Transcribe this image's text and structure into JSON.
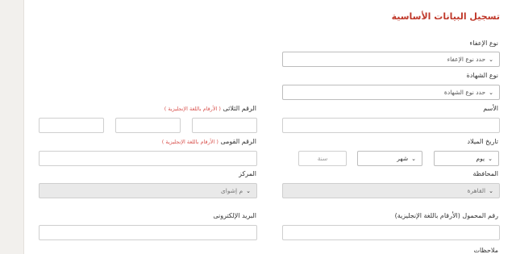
{
  "title": "تسجيل البيانات الأساسية",
  "exemption_type": {
    "label": "نوع الإعفاء",
    "value": "حدد نوع الإعفاء"
  },
  "certificate_type": {
    "label": "نوع الشهادة",
    "value": "حدد نوع الشهادة"
  },
  "name": {
    "label": "الأسم"
  },
  "triple_number": {
    "label": "الرقم الثلاثى",
    "hint": "( الأرقام باللغة الإنجليزية )"
  },
  "birth_date": {
    "label": "تاريخ الميلاد",
    "day": "يوم",
    "month": "شهر",
    "year_placeholder": "سنة"
  },
  "national_id": {
    "label": "الرقم القومى",
    "hint": "( الأرقام باللغة الإنجليزية )"
  },
  "governorate": {
    "label": "المحافظة",
    "value": "القاهرة"
  },
  "center": {
    "label": "المركز",
    "value": "م إشواى"
  },
  "mobile": {
    "label": "رقم المحمول (الأرقام باللغة الإنجليزية)"
  },
  "email": {
    "label": "البريد الإلكترونى"
  },
  "notes": {
    "label": "ملاحظات"
  }
}
